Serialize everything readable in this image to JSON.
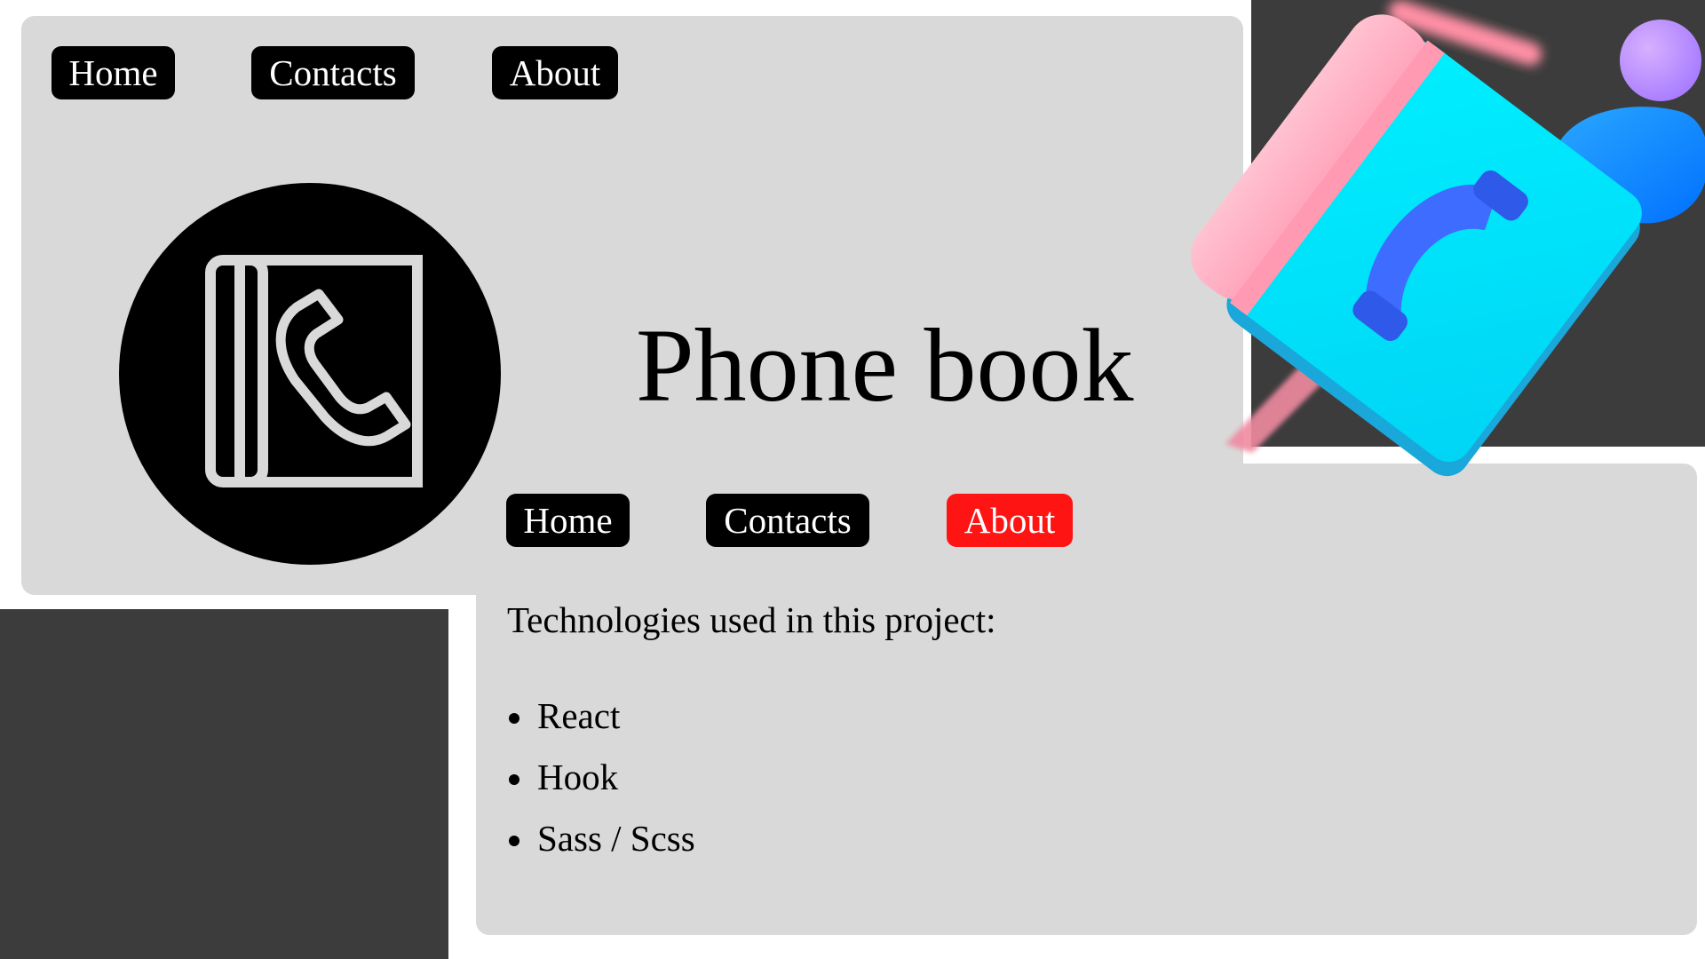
{
  "home_view": {
    "nav": {
      "home_label": "Home",
      "contacts_label": "Contacts",
      "about_label": "About"
    },
    "title": "Phone book",
    "logo_icon": "phone-book-icon"
  },
  "about_view": {
    "nav": {
      "home_label": "Home",
      "contacts_label": "Contacts",
      "about_label": "About",
      "active": "About"
    },
    "heading": "Technologies used in this project:",
    "technologies": [
      "React",
      "Hook",
      "Sass / Scss"
    ]
  },
  "illustration_icon": "phone-book-3d-icon",
  "colors": {
    "panel_bg": "#d9d9d9",
    "dark_bg": "#3c3c3c",
    "nav_bg": "#000000",
    "nav_text": "#ffffff",
    "nav_active_bg": "#ff1414",
    "book_cover": "#00e8ff",
    "book_spine": "#ffb3c6",
    "handset": "#3d6cff"
  }
}
